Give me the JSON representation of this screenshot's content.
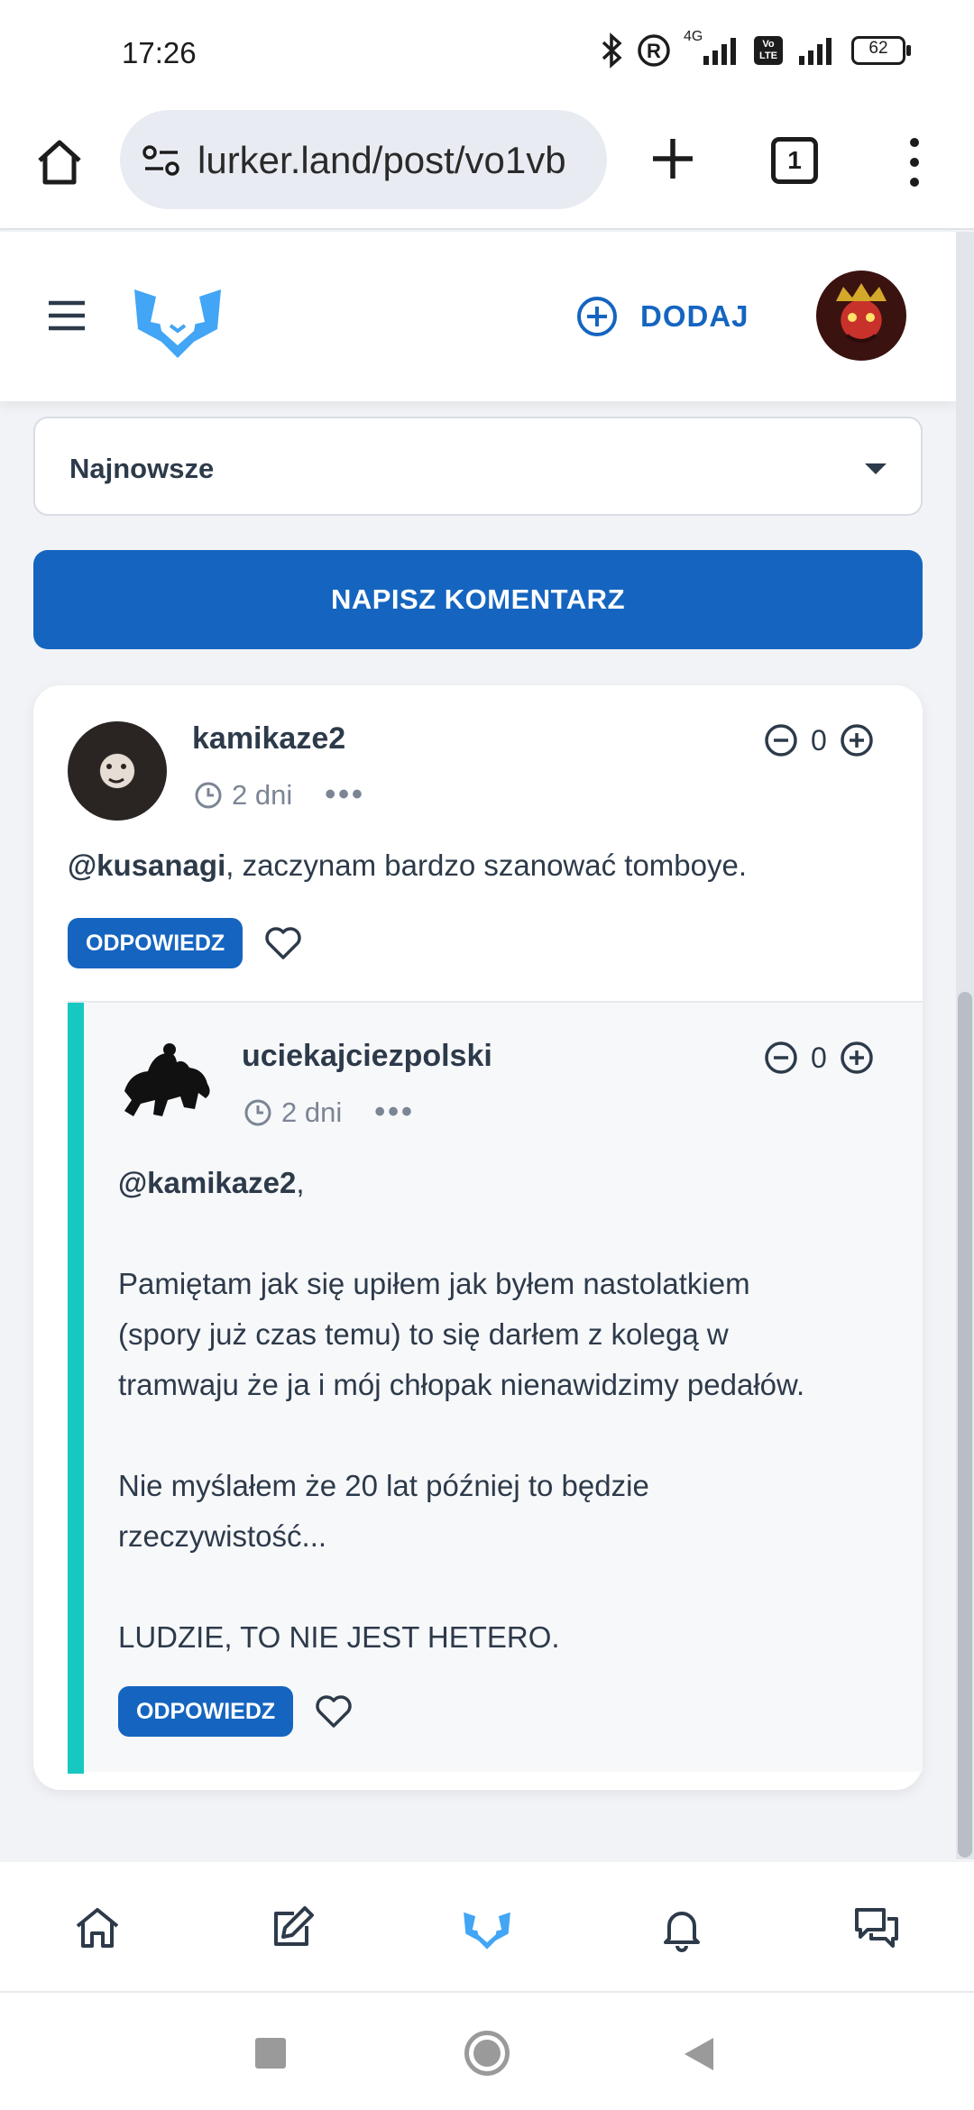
{
  "status_bar": {
    "time": "17:26",
    "battery": "62",
    "network_label": "4G",
    "volte_label": "Vo LTE"
  },
  "browser": {
    "url": "lurker.land/post/vo1vb",
    "tab_count": "1"
  },
  "header": {
    "add_label": "DODAJ"
  },
  "sort": {
    "selected": "Najnowsze"
  },
  "comment_button_label": "NAPISZ KOMENTARZ",
  "comments": [
    {
      "username": "kamikaze2",
      "time": "2 dni",
      "score": "0",
      "mention": "@kusanagi",
      "text": ", zaczynam bardzo szanować tomboye.",
      "reply_label": "ODPOWIEDZ"
    },
    {
      "username": "uciekajciezpolski",
      "time": "2 dni",
      "score": "0",
      "mention": "@kamikaze2",
      "mention_suffix": ",",
      "paragraph1_line1": "Pamiętam jak się upiłem jak byłem nastolatkiem",
      "paragraph1_line2": "(spory już czas temu) to się darłem z kolegą w",
      "paragraph1_line3": "tramwaju że ja i mój chłopak nienawidzimy pedałów.",
      "paragraph2_line1": "Nie myślałem że 20 lat później to będzie",
      "paragraph2_line2": "rzeczywistość...",
      "paragraph3": "LUDZIE, TO NIE JEST HETERO.",
      "reply_label": "ODPOWIEDZ"
    }
  ],
  "colors": {
    "accent": "#1565c0",
    "logo": "#42a5f5",
    "thread_bar": "#17c8c0",
    "text": "#2d3a4a"
  }
}
